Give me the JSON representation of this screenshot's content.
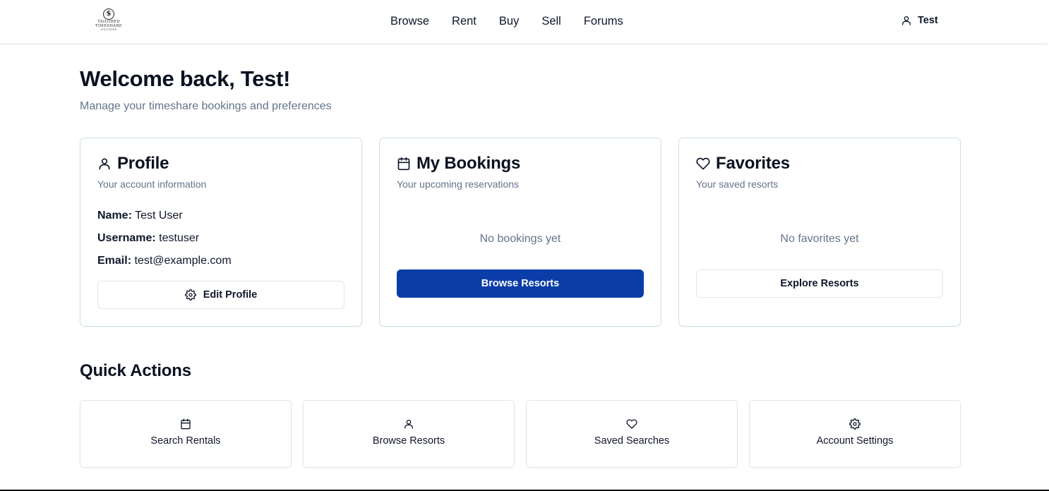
{
  "header": {
    "logo": {
      "line1": "TAILORED",
      "line2": "TIMESHARE",
      "line3": "SOLUTIONS"
    },
    "nav": [
      "Browse",
      "Rent",
      "Buy",
      "Sell",
      "Forums"
    ],
    "user_label": "Test",
    "user_icon": "user-icon"
  },
  "page": {
    "title": "Welcome back, Test!",
    "subtitle": "Manage your timeshare bookings and preferences"
  },
  "profile": {
    "icon": "user-icon",
    "title": "Profile",
    "subtitle": "Your account information",
    "name_label": "Name:",
    "name_value": "Test User",
    "username_label": "Username:",
    "username_value": "testuser",
    "email_label": "Email:",
    "email_value": "test@example.com",
    "button_icon": "gear-icon",
    "button_label": "Edit Profile"
  },
  "bookings": {
    "icon": "calendar-icon",
    "title": "My Bookings",
    "subtitle": "Your upcoming reservations",
    "empty_text": "No bookings yet",
    "button_label": "Browse Resorts"
  },
  "favorites": {
    "icon": "heart-icon",
    "title": "Favorites",
    "subtitle": "Your saved resorts",
    "empty_text": "No favorites yet",
    "button_label": "Explore Resorts"
  },
  "quick_actions": {
    "title": "Quick Actions",
    "items": [
      {
        "icon": "calendar-icon",
        "label": "Search Rentals"
      },
      {
        "icon": "user-icon",
        "label": "Browse Resorts"
      },
      {
        "icon": "heart-icon",
        "label": "Saved Searches"
      },
      {
        "icon": "gear-icon",
        "label": "Account Settings"
      }
    ]
  },
  "colors": {
    "primary": "#0b3da8",
    "border": "#cfe2df",
    "muted_text": "#64748b"
  }
}
